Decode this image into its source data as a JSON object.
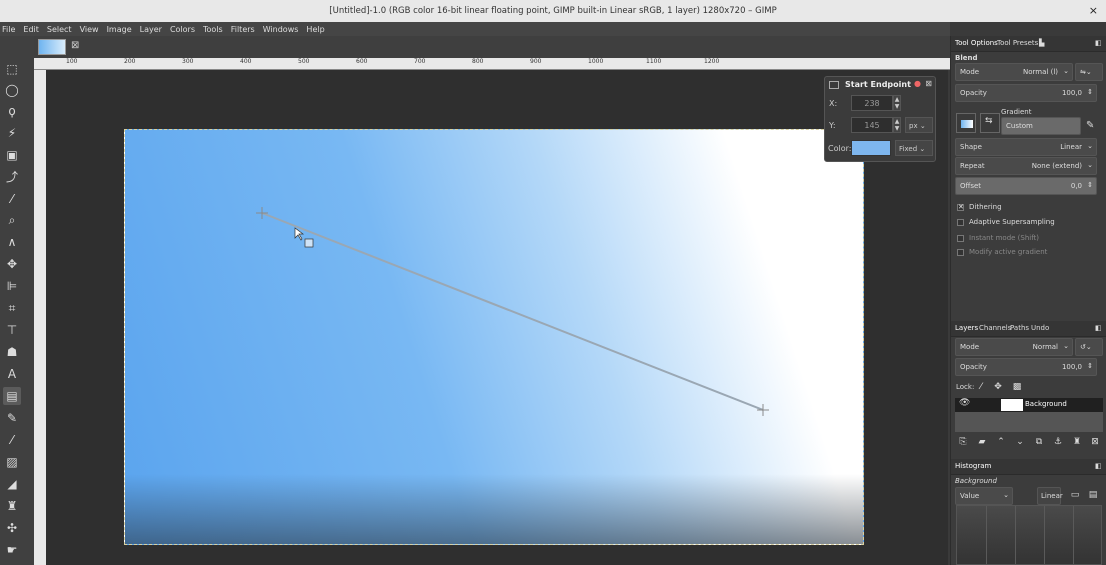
{
  "window": {
    "title": "[Untitled]-1.0 (RGB color 16-bit linear floating point, GIMP built-in Linear sRGB, 1 layer) 1280x720 – GIMP",
    "close": "×"
  },
  "menu": [
    "File",
    "Edit",
    "Select",
    "View",
    "Image",
    "Layer",
    "Colors",
    "Tools",
    "Filters",
    "Windows",
    "Help"
  ],
  "ruler_top": [
    "100",
    "200",
    "300",
    "400",
    "500",
    "600",
    "700",
    "800",
    "900",
    "1000",
    "1100",
    "1200"
  ],
  "start_endpoint": {
    "title": "Start Endpoint",
    "x_label": "X:",
    "x_value": "238",
    "y_label": "Y:",
    "y_value": "145",
    "unit": "px",
    "color_label": "Color:",
    "color_mode": "Fixed",
    "color": "#7eb6ee"
  },
  "tool_options": {
    "tabs": [
      "Tool Options",
      "Tool Presets"
    ],
    "tool_name": "Blend",
    "mode_label": "Mode",
    "mode_value": "Normal (l)",
    "opacity_label": "Opacity",
    "opacity_value": "100,0",
    "gradient_label": "Gradient",
    "gradient_value": "Custom",
    "shape_label": "Shape",
    "shape_value": "Linear",
    "repeat_label": "Repeat",
    "repeat_value": "None (extend)",
    "offset_label": "Offset",
    "offset_value": "0,0",
    "dithering": "Dithering",
    "adaptive": "Adaptive Supersampling",
    "instant": "Instant mode  (Shift)",
    "modify": "Modify active gradient"
  },
  "layers": {
    "tabs": [
      "Layers",
      "Channels",
      "Paths",
      "Undo"
    ],
    "mode_label": "Mode",
    "mode_value": "Normal",
    "opacity_label": "Opacity",
    "opacity_value": "100,0",
    "lock_label": "Lock:",
    "layer_name": "Background"
  },
  "histogram": {
    "tab": "Histogram",
    "drawable": "Background",
    "channel": "Value",
    "scale": "Linear"
  }
}
